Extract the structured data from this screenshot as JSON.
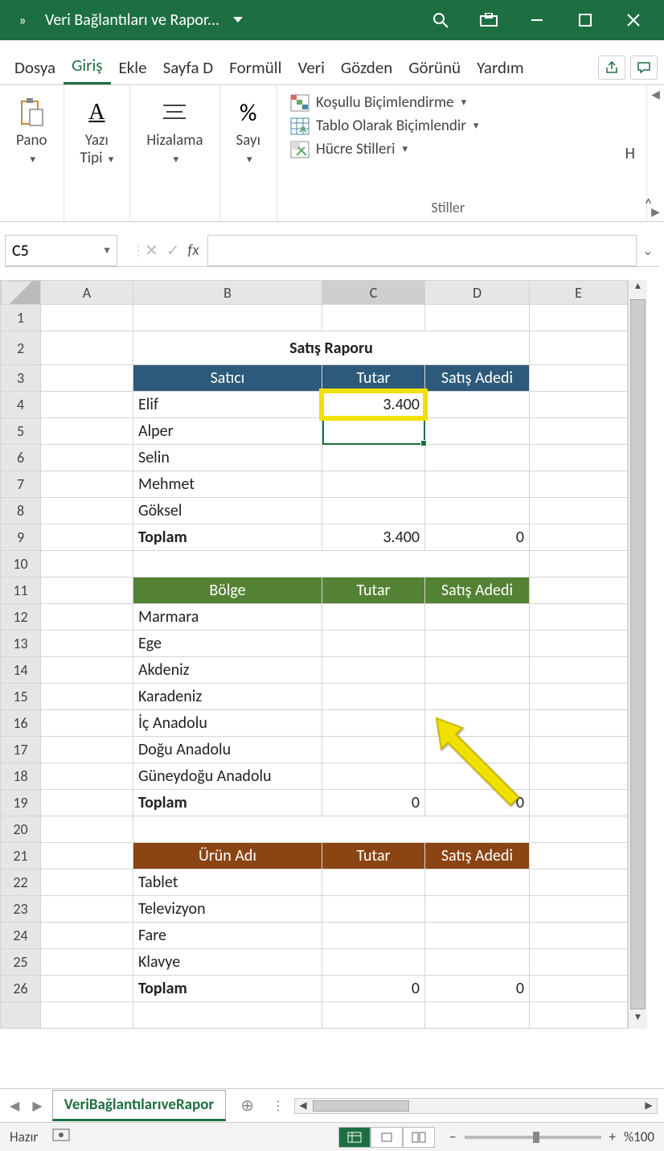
{
  "titlebar": {
    "title": "Veri Bağlantıları ve Rapor..."
  },
  "tabs": {
    "items": [
      "Dosya",
      "Giriş",
      "Ekle",
      "Sayfa D",
      "Formüll",
      "Veri",
      "Gözden",
      "Görünü",
      "Yardım"
    ],
    "active_index": 1
  },
  "ribbon": {
    "pano": {
      "label": "Pano"
    },
    "yazi": {
      "label": "Yazı\nTipi"
    },
    "hiza": {
      "label": "Hizalama"
    },
    "sayi": {
      "label": "Sayı"
    },
    "styles": {
      "cond": "Koşullu Biçimlendirme",
      "table": "Tablo Olarak Biçimlendir",
      "cell": "Hücre Stilleri",
      "group": "Stiller"
    },
    "cellsGroupLetter": "H"
  },
  "namebox": "C5",
  "formula": "",
  "colHeaders": [
    "A",
    "B",
    "C",
    "D",
    "E"
  ],
  "report": {
    "title": "Satış Raporu",
    "table1": {
      "headers": [
        "Satıcı",
        "Tutar",
        "Satış Adedi"
      ],
      "rows": [
        {
          "name": "Elif",
          "amount": "3.400",
          "count": ""
        },
        {
          "name": "Alper",
          "amount": "",
          "count": ""
        },
        {
          "name": "Selin",
          "amount": "",
          "count": ""
        },
        {
          "name": "Mehmet",
          "amount": "",
          "count": ""
        },
        {
          "name": "Göksel",
          "amount": "",
          "count": ""
        }
      ],
      "total": {
        "label": "Toplam",
        "amount": "3.400",
        "count": "0"
      }
    },
    "table2": {
      "headers": [
        "Bölge",
        "Tutar",
        "Satış Adedi"
      ],
      "rows": [
        {
          "name": "Marmara"
        },
        {
          "name": "Ege"
        },
        {
          "name": "Akdeniz"
        },
        {
          "name": "Karadeniz"
        },
        {
          "name": "İç Anadolu"
        },
        {
          "name": "Doğu Anadolu"
        },
        {
          "name": "Güneydoğu Anadolu"
        }
      ],
      "total": {
        "label": "Toplam",
        "amount": "0",
        "count": "0"
      }
    },
    "table3": {
      "headers": [
        "Ürün Adı",
        "Tutar",
        "Satış Adedi"
      ],
      "rows": [
        {
          "name": "Tablet"
        },
        {
          "name": "Televizyon"
        },
        {
          "name": "Fare"
        },
        {
          "name": "Klavye"
        }
      ],
      "total": {
        "label": "Toplam",
        "amount": "0",
        "count": "0"
      }
    }
  },
  "sheet": {
    "name": "VeriBağlantılarıveRapor"
  },
  "status": {
    "ready": "Hazır",
    "zoom": "%100"
  }
}
